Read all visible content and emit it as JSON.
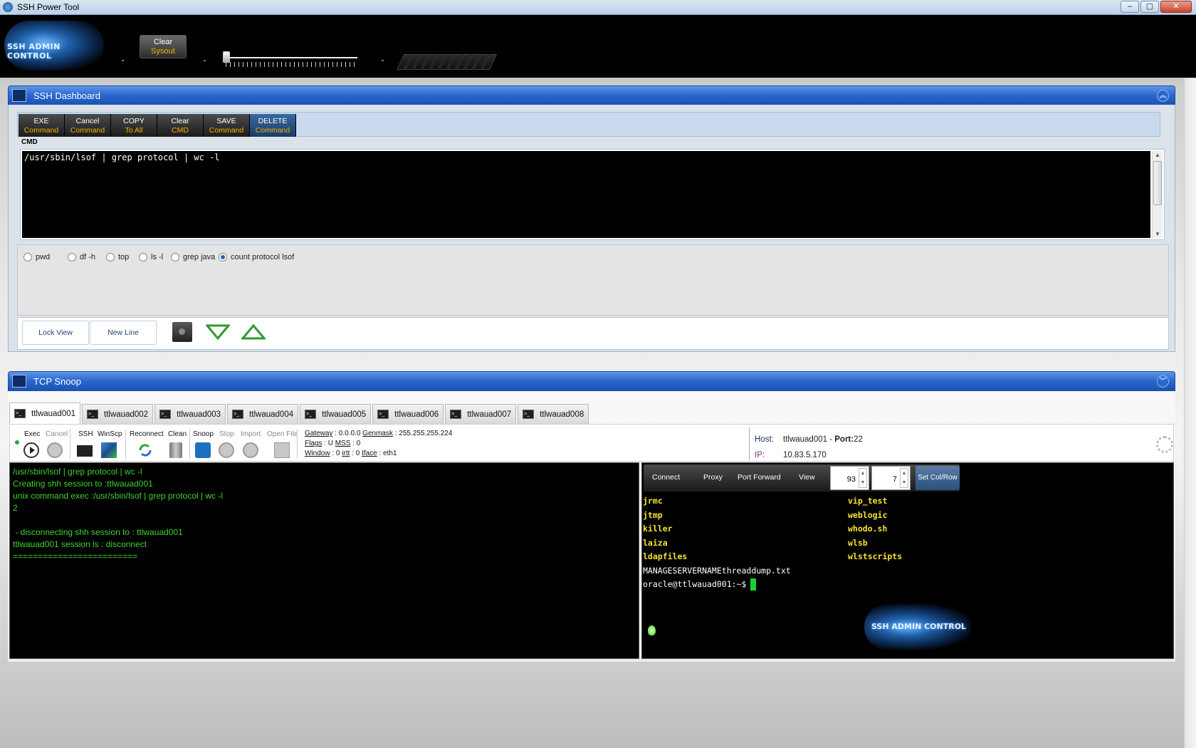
{
  "window": {
    "title": "SSH Power Tool",
    "min": "–",
    "max": "▢",
    "close": "✕"
  },
  "toolbar": {
    "logo_text": "SSH ADMIN CONTROL",
    "clear_label": "Clear",
    "clear_sub": "Sysout",
    "slider_value": 0
  },
  "dashboard": {
    "title": "SSH Dashboard",
    "buttons": [
      {
        "label": "EXE",
        "sub": "Command"
      },
      {
        "label": "Cancel",
        "sub": "Command"
      },
      {
        "label": "COPY",
        "sub": "To All"
      },
      {
        "label": "Clear",
        "sub": "CMD"
      },
      {
        "label": "SAVE",
        "sub": "Command"
      },
      {
        "label": "DELETE",
        "sub": "Command"
      }
    ],
    "cmd_label": "CMD",
    "cmd_text": "/usr/sbin/lsof | grep protocol | wc -l",
    "presets": [
      {
        "label": "pwd",
        "selected": false
      },
      {
        "label": "df -h",
        "selected": false
      },
      {
        "label": "top",
        "selected": false
      },
      {
        "label": "ls -l",
        "selected": false
      },
      {
        "label": "grep java",
        "selected": false
      },
      {
        "label": "count protocol lsof",
        "selected": true
      }
    ],
    "lock_view": "Lock View",
    "new_line": "New Line"
  },
  "snoop": {
    "title": "TCP Snoop",
    "tabs": [
      "ttlwauad001",
      "ttlwauad002",
      "ttlwauad003",
      "ttlwauad004",
      "ttlwauad005",
      "ttlwauad006",
      "ttlwauad007",
      "ttlwauad008"
    ],
    "tools": {
      "exec": "Exec",
      "cancel": "Cancel",
      "ssh": "SSH",
      "winscp": "WinScp",
      "reconnect": "Reconnect",
      "clean": "Clean",
      "snoop": "Snoop",
      "stop": "Stop",
      "import": "Import",
      "open_file": "Open File"
    },
    "net": {
      "gateway_k": "Gateway",
      "gateway_v": " : 0.0.0.0 ",
      "genmask_k": "Genmask",
      "genmask_v": " : 255.255.255.224",
      "flags_k": "Flags",
      "flags_v": " : U ",
      "mss_k": "MSS",
      "mss_v": " : 0",
      "window_k": "Window",
      "window_v": " : 0 ",
      "irtt_k": "irtt",
      "irtt_v": " : 0 ",
      "iface_k": "Iface",
      "iface_v": " : eth1"
    },
    "host": {
      "host_k": "Host:",
      "host_v": "ttlwauad001 - ",
      "port_k": "Port:",
      "port_v": "22",
      "ip_k": "IP:",
      "ip_v": "10.83.5.170"
    },
    "log": [
      "/usr/sbin/lsof | grep protocol | wc -l",
      "Creating shh session to :ttlwauad001",
      "unix command exec :/usr/sbin/lsof | grep protocol | wc -l",
      "2",
      "",
      " - disconnecting shh session to : ttlwauad001",
      "ttlwauad001 session is : disconnect",
      "========================="
    ],
    "term": {
      "connect": "Connect",
      "proxy": "Proxy",
      "port_forward": "Port Forward",
      "view": "View",
      "cols": "93",
      "rows": "7",
      "set": "Set Col/Row",
      "col1": [
        "jrmc",
        "jtmp",
        "killer",
        "laiza",
        "ldapfiles"
      ],
      "col2": [
        "vip_test",
        "weblogic",
        "whodo.sh",
        "wlsb",
        "wlstscripts"
      ],
      "line_file": "MANAGESERVERNAMEthreaddump.txt",
      "prompt": "oracle@ttlwauad001:~$",
      "logo_text": "SSH ADMIN CONTROL"
    }
  }
}
